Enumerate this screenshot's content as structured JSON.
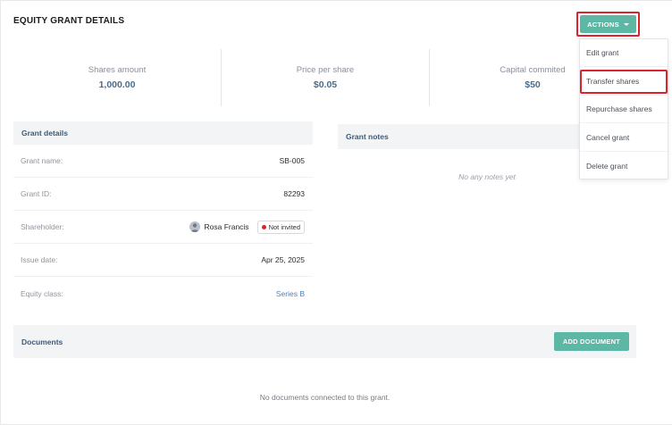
{
  "page": {
    "title": "EQUITY GRANT DETAILS"
  },
  "actions": {
    "label": "ACTIONS",
    "menu": [
      "Edit grant",
      "Transfer shares",
      "Repurchase shares",
      "Cancel grant",
      "Delete grant"
    ]
  },
  "stats": [
    {
      "label": "Shares amount",
      "value": "1,000.00"
    },
    {
      "label": "Price per share",
      "value": "$0.05"
    },
    {
      "label": "Capital commited",
      "value": "$50"
    }
  ],
  "grant_details": {
    "heading": "Grant details",
    "rows": [
      {
        "label": "Grant name:",
        "value": "SB-005"
      },
      {
        "label": "Grant ID:",
        "value": "82293"
      },
      {
        "label": "Shareholder:",
        "value": "Rosa Francis",
        "badge": "Not invited"
      },
      {
        "label": "Issue date:",
        "value": "Apr 25, 2025"
      },
      {
        "label": "Equity class:",
        "value": "Series B"
      }
    ]
  },
  "grant_notes": {
    "heading": "Grant notes",
    "empty": "No any notes yet"
  },
  "documents": {
    "heading": "Documents",
    "add_label": "ADD DOCUMENT",
    "empty": "No documents connected to this grant."
  },
  "colors": {
    "accent": "#5cb8a4",
    "highlight": "#d9232d",
    "link": "#4b82b6",
    "status_dot": "#d9232d"
  }
}
